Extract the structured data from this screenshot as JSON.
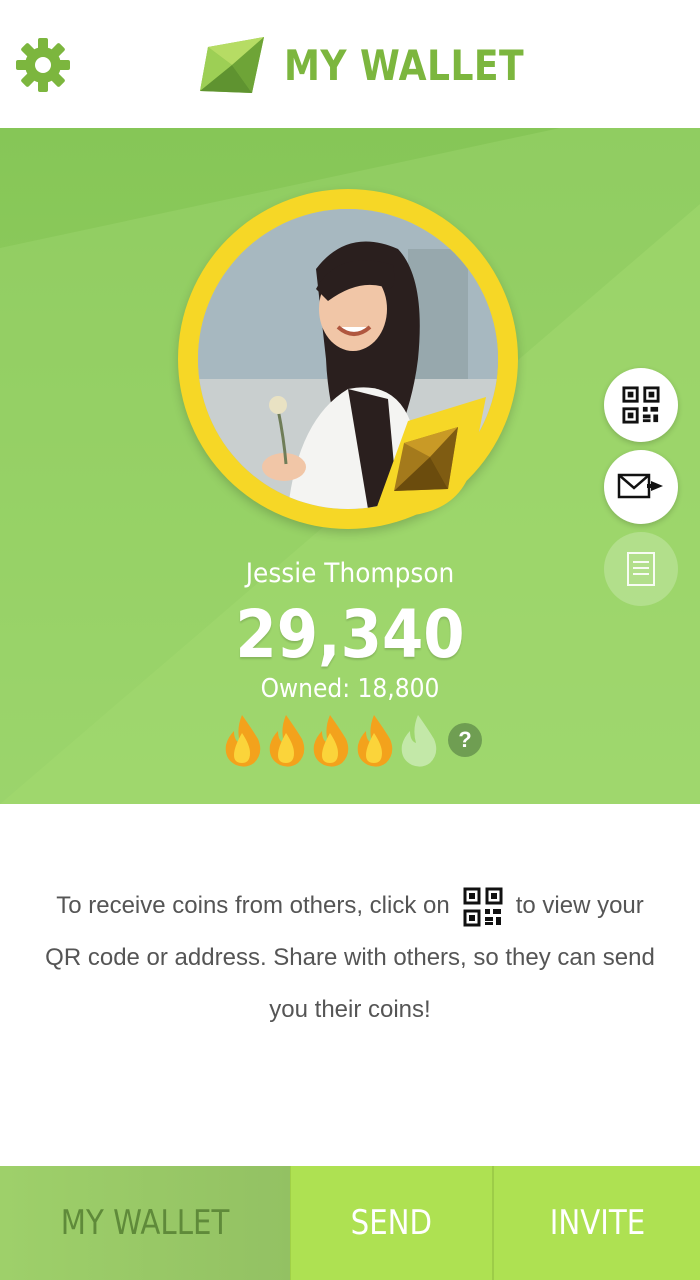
{
  "header": {
    "title": "MY WALLET",
    "settings_icon": "gear-icon",
    "logo_icon": "wallet-gem-icon",
    "brand_color": "#7cb63e"
  },
  "profile": {
    "name": "Jessie Thompson",
    "balance": "29,340",
    "owned": "Owned: 18,800",
    "rating": {
      "filled": 4,
      "total": 5
    },
    "help_label": "?"
  },
  "actions": [
    {
      "icon": "qr-code-icon",
      "enabled": true
    },
    {
      "icon": "send-mail-icon",
      "enabled": true
    },
    {
      "icon": "document-icon",
      "enabled": false
    }
  ],
  "info": {
    "line_before_icon": "To receive coins from others, click on",
    "line_after_icon": "to view your QR code or address. Share with others, so they can send you their coins!",
    "inline_icon": "qr-code-icon"
  },
  "tabs": [
    {
      "label": "MY WALLET",
      "active": true
    },
    {
      "label": "SEND",
      "active": false
    },
    {
      "label": "INVITE",
      "active": false
    }
  ],
  "colors": {
    "hero_green": "#8ecb5c",
    "ring_yellow": "#f6d726",
    "tab_green": "#aee152"
  }
}
